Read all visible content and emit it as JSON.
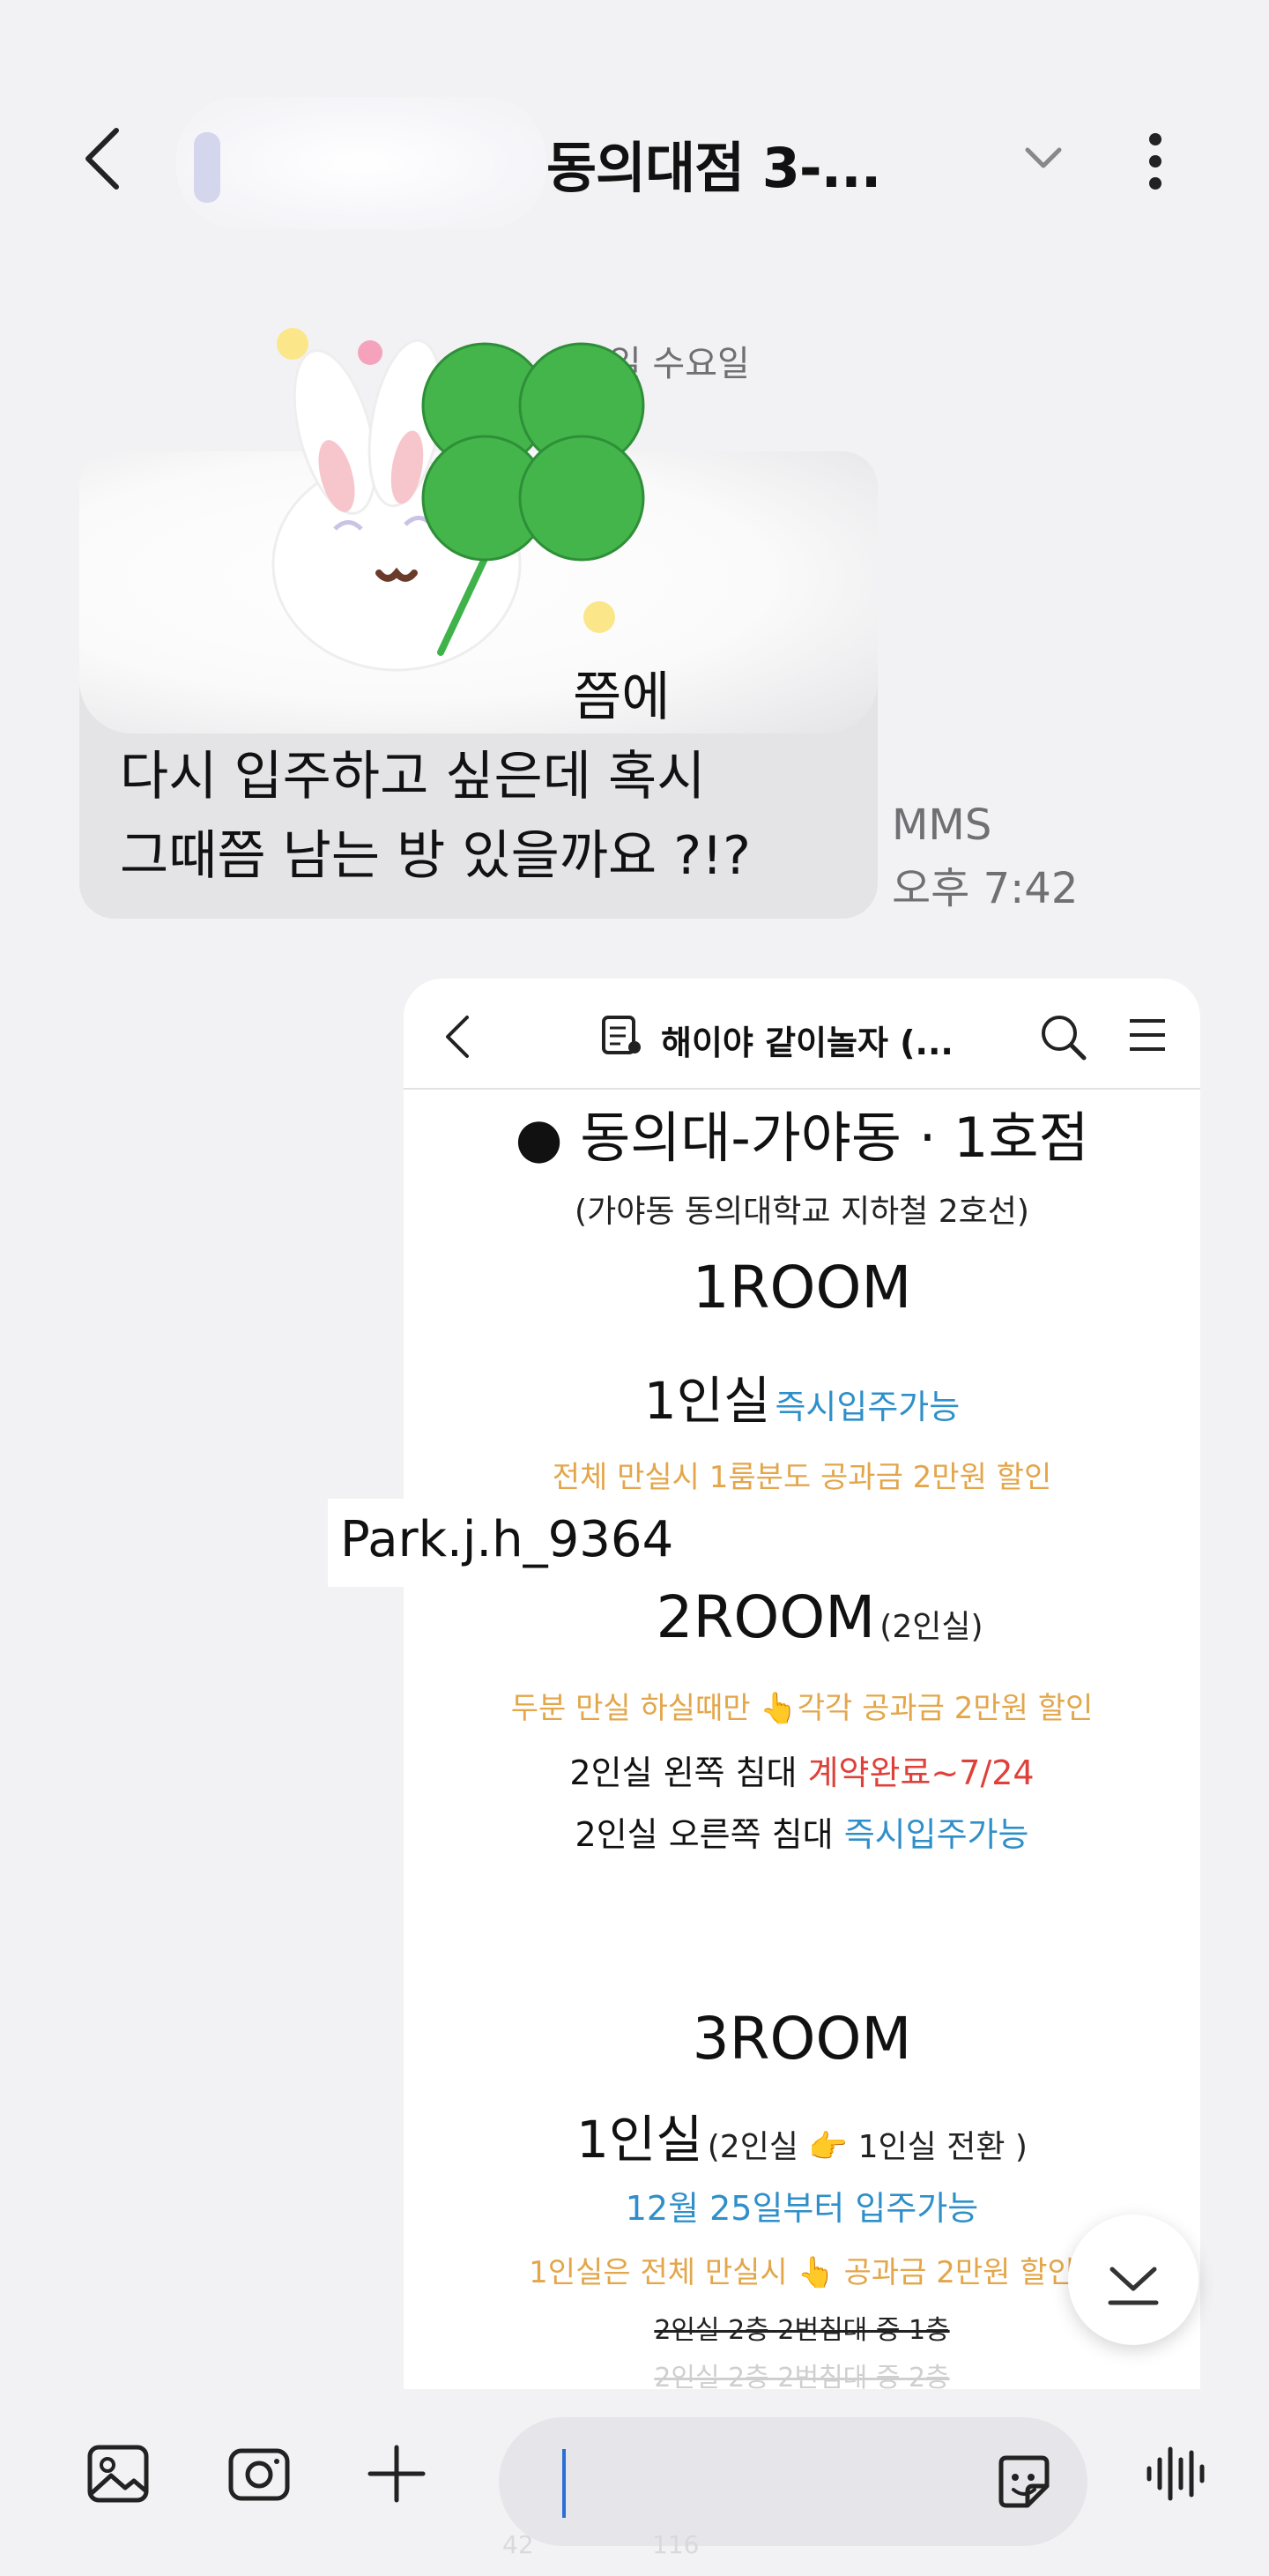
{
  "header": {
    "title": "동의대점 3-...",
    "back_icon": "chevron-left-icon",
    "dropdown_icon": "chevron-down-icon",
    "more_icon": "more-vertical-icon"
  },
  "conversation": {
    "date_label": "29일 수요일",
    "incoming": {
      "lines": [
        "쯤에",
        "다시 입주하고 싶은데 혹시",
        "그때쯤 남는 방 있을까요 ?!?"
      ],
      "type": "MMS",
      "time": "오후 7:42"
    }
  },
  "shared_image": {
    "app_title": "해이야 같이놀자 (...",
    "heading": "● 동의대-가야동 · 1호점",
    "subheading": "(가야동 동의대학교 지하철 2호선)",
    "room1": {
      "title": "1ROOM",
      "line": "1인실",
      "status": "즉시입주가능",
      "note": "전체 만실시 1룸분도 공과금 2만원 할인"
    },
    "room2": {
      "title": "2ROOM",
      "suffix": "(2인실)",
      "note": "두분 만실 하실때만 👆각각 공과금 2만원 할인",
      "left_bed": "2인실 왼쪽 침대",
      "left_status": "계약완료~7/24",
      "right_bed": "2인실 오른쪽 침대",
      "right_status": "즉시입주가능"
    },
    "room3": {
      "title": "3ROOM",
      "line": "1인실",
      "suffix": "(2인실 👉 1인실 전환 )",
      "available": "12월 25일부터 입주가능",
      "note": "1인실은 전체 만실시 👆 공과금 2만원 할인",
      "strike1": "2인실 2층 2번침대 중 1층",
      "strike2": "2인실 2층 2번침대 중 2층"
    },
    "watermark": "Park.j.h_9364"
  },
  "footer": {
    "gallery_icon": "image-icon",
    "camera_icon": "camera-icon",
    "add_icon": "plus-icon",
    "emoji_icon": "sticker-icon",
    "voice_icon": "voice-wave-icon",
    "ghost_likes": "42",
    "ghost_comments": "116"
  },
  "colors": {
    "background": "#f2f2f4",
    "incoming_bubble": "#e4e4e7",
    "status_blue": "#2f8fc9",
    "status_red": "#e0403a",
    "note_orange": "#e3a64a",
    "caret": "#2b6fd6"
  }
}
